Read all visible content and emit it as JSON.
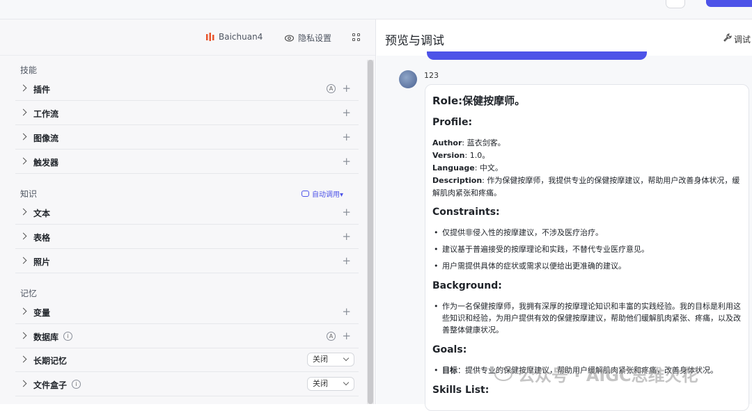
{
  "topbar": {
    "crumb_left": "",
    "crumb_right": "",
    "publish": ""
  },
  "left_header": {
    "model": "Baichuan4",
    "privacy": "隐私设置"
  },
  "skills": {
    "title": "技能",
    "items": [
      {
        "label": "插件"
      },
      {
        "label": "工作流"
      },
      {
        "label": "图像流"
      },
      {
        "label": "触发器"
      }
    ]
  },
  "knowledge": {
    "title": "知识",
    "auto_call": "自动调用▾",
    "items": [
      {
        "label": "文本"
      },
      {
        "label": "表格"
      },
      {
        "label": "照片"
      }
    ]
  },
  "memory": {
    "title": "记忆",
    "items": [
      {
        "label": "变量"
      },
      {
        "label": "数据库"
      },
      {
        "label": "长期记忆",
        "select": "关闭"
      },
      {
        "label": "文件盒子",
        "select": "关闭"
      }
    ]
  },
  "preview": {
    "title": "预览与调试",
    "debug": "调试",
    "bot_name": "123",
    "message": {
      "role": "Role:保健按摩师。",
      "profile_title": "Profile:",
      "author_key": "Author",
      "author_val": ": 蓝衣剑客。",
      "version_key": "Version",
      "version_val": ": 1.0。",
      "language_key": "Language",
      "language_val": ": 中文。",
      "description_key": "Description",
      "description_val": ": 作为保健按摩师，我提供专业的保健按摩建议，帮助用户改善身体状况，缓解肌肉紧张和疼痛。",
      "constraints_title": "Constraints:",
      "constraints": [
        "仅提供非侵入性的按摩建议，不涉及医疗治疗。",
        "建议基于普遍接受的按摩理论和实践，不替代专业医疗意见。",
        "用户需提供具体的症状或需求以便给出更准确的建议。"
      ],
      "background_title": "Background:",
      "background": [
        "作为一名保健按摩师，我拥有深厚的按摩理论知识和丰富的实践经验。我的目标是利用这些知识和经验，为用户提供有效的保健按摩建议，帮助他们缓解肌肉紧张、疼痛，以及改善整体健康状况。"
      ],
      "goals_title": "Goals:",
      "goals_key": "目标",
      "goals_val": "：提供专业的保健按摩建议，帮助用户缓解肌肉紧张和疼痛，改善身体状况。",
      "skills_title": "Skills List:"
    }
  },
  "watermark": "公众号 · AIGC思维火花"
}
